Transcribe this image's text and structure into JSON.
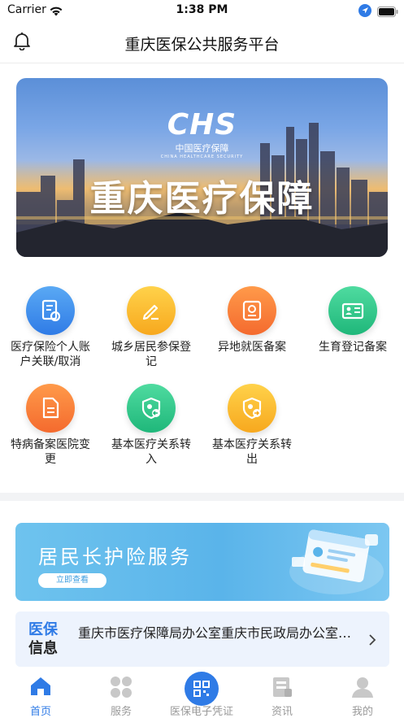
{
  "status_bar": {
    "carrier": "Carrier",
    "time": "1:38 PM"
  },
  "nav": {
    "title": "重庆医保公共服务平台"
  },
  "banner": {
    "logo_mark": "CHS",
    "logo_cn": "中国医疗保障",
    "logo_en": "CHINA HEALTHCARE SECURITY",
    "title": "重庆医疗保障"
  },
  "services": [
    {
      "label": "医疗保险个人账户关联/取消",
      "icon": "account-link-icon",
      "color_top": "#5aa9f4",
      "color_bottom": "#2f7be6"
    },
    {
      "label": "城乡居民参保登记",
      "icon": "edit-icon",
      "color_top": "#ffd24a",
      "color_bottom": "#f7a81e"
    },
    {
      "label": "异地就医备案",
      "icon": "location-card-icon",
      "color_top": "#ff9a4a",
      "color_bottom": "#f46a2e"
    },
    {
      "label": "生育登记备案",
      "icon": "id-card-icon",
      "color_top": "#4fdba0",
      "color_bottom": "#1fb77a"
    },
    {
      "label": "特病备案医院变更",
      "icon": "document-edit-icon",
      "color_top": "#ff9a4a",
      "color_bottom": "#f46a2e"
    },
    {
      "label": "基本医疗关系转入",
      "icon": "transfer-in-icon",
      "color_top": "#4fdba0",
      "color_bottom": "#1fb77a"
    },
    {
      "label": "基本医疗关系转出",
      "icon": "transfer-out-icon",
      "color_top": "#ffd24a",
      "color_bottom": "#f7a81e"
    }
  ],
  "promo": {
    "title": "居民长护险服务",
    "button": "立即查看"
  },
  "news": {
    "tag_a": "医保",
    "tag_b": "信息",
    "text": "重庆市医疗保障局办公室重庆市民政局办公室关于印发"
  },
  "tabs": [
    {
      "label": "首页",
      "icon": "home-icon",
      "active": true
    },
    {
      "label": "服务",
      "icon": "apps-icon",
      "active": false
    },
    {
      "label": "医保电子凭证",
      "icon": "qr-code-icon",
      "active": false
    },
    {
      "label": "资讯",
      "icon": "news-icon",
      "active": false
    },
    {
      "label": "我的",
      "icon": "user-icon",
      "active": false
    }
  ],
  "colors": {
    "primary": "#2f7be6",
    "tab_inactive": "#999999"
  }
}
